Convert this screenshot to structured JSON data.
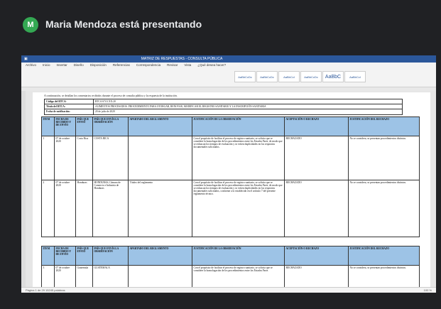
{
  "meeting": {
    "avatar_letter": "M",
    "presenter_text": "Maria Mendoza está presentando"
  },
  "word": {
    "title": "MATRIZ DE RESPUESTAS - CONSULTA PÚBLICA",
    "menu": [
      "Archivo",
      "Inicio",
      "Insertar",
      "Diseño",
      "Disposición",
      "Referencias",
      "Correspondencia",
      "Revisar",
      "Vista",
      "¿Qué desea hacer?"
    ],
    "styles": [
      "AaBbCcDc",
      "AaBbCcDc",
      "AaBbCcI",
      "AaBbCcDc",
      "AaBbC",
      "AaBbCcI"
    ],
    "status_left": "Página 1 de 29   15245 palabras",
    "status_right": "100 %"
  },
  "doc": {
    "intro": "A continuación, se detallan los comentarios recibidos durante el proceso de consulta pública y la respuesta de la institución.",
    "info": [
      {
        "k": "Código del RTCA:",
        "v": "RTCA 67.01.XX:20"
      },
      {
        "k": "Título del RTCA:",
        "v": "ALIMENTOS PROCESADOS. PROCEDIMIENTO PARA OTORGAR, RENOVAR, MODIFICAR EL REGISTRO SANITARIO Y LA INSCRIPCIÓN SANITARIA"
      },
      {
        "k": "Fecha de notificación:",
        "v": "20 de julio de 2020"
      }
    ],
    "headers": [
      "ITEM",
      "FECHA DE RECIBIDO Y DE ENVÍO",
      "PAÍS QUE ENVIÓ",
      "PAÍS QUE ENVÍA LA OBSERVACIÓN",
      "APARTADO DEL REGLAMENTO",
      "JUSTIFICACIÓN DE LA OBSERVACIÓN",
      "ACEPTACIÓN O RECHAZO",
      "JUSTIFICACIÓN DEL RECHAZO"
    ],
    "rows": [
      {
        "item": "1",
        "fecha": "07 de octubre 2020",
        "pais": "Costa Rica",
        "pais_envia": "COSTA RICA",
        "apartado": "",
        "justificacion": "Con el propósito de facilitar el proceso de registro sanitario, se solicita que se considere la homologación de los procedimientos entre los Estados Parte, de modo que se reduzcan los tiempos de evaluación y se eviten duplicidades en los requisitos documentales solicitados.",
        "aceptacion": "RECHAZADO",
        "rechazo": "No se considera, se presentan procedimientos distintos."
      },
      {
        "item": "2",
        "fecha": "07 de octubre 2020",
        "pais": "Honduras",
        "pais_envia": "HONDURAS, Cámara de Comercio e Industria de Honduras",
        "apartado": "Títulos del reglamento",
        "justificacion": "Con el propósito de facilitar el proceso de registro sanitario, se solicita que se considere la homologación de los procedimientos entre los Estados Parte, de modo que se reduzcan los tiempos de evaluación y se eviten duplicidades en los requisitos documentales solicitados, conforme a lo establecido en el artículo 7 del presente reglamento técnico.",
        "aceptacion": "RECHAZADO",
        "rechazo": "No se considera, se presentan procedimientos distintos."
      },
      {
        "item": "3",
        "fecha": "07 de octubre 2020",
        "pais": "Guatemala",
        "pais_envia": "GUATEMALA",
        "apartado": "",
        "justificacion": "Con el propósito de facilitar el proceso de registro sanitario, se solicita que se considere la homologación de los procedimientos entre los Estados Parte.",
        "aceptacion": "RECHAZADO",
        "rechazo": "No se considera, se presentan procedimientos distintos."
      }
    ]
  }
}
